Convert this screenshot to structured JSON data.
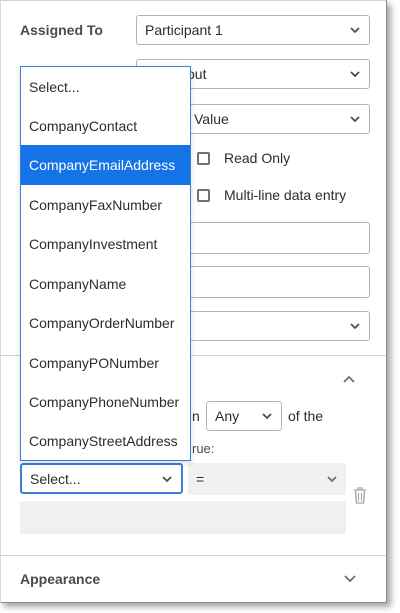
{
  "assigned_to": {
    "label": "Assigned To",
    "value": "Participant 1"
  },
  "row2": {
    "value_partial": "out"
  },
  "row3": {
    "value_partial": "l Value"
  },
  "checkboxes": {
    "read_only": "Read Only",
    "multiline": "Multi-line data entry"
  },
  "condition": {
    "text_before": "n",
    "any_value": "Any",
    "text_after": "of the",
    "text_line2": "rue:",
    "field_select": "Select...",
    "operator": "="
  },
  "appearance": {
    "label": "Appearance"
  },
  "dropdown": {
    "items": [
      "Select...",
      "CompanyContact",
      "CompanyEmailAddress",
      "CompanyFaxNumber",
      "CompanyInvestment",
      "CompanyName",
      "CompanyOrderNumber",
      "CompanyPONumber",
      "CompanyPhoneNumber",
      "CompanyStreetAddress"
    ],
    "selected": "CompanyEmailAddress"
  },
  "colors": {
    "selection": "#1473e6",
    "focus_border": "#3a7fd8"
  }
}
